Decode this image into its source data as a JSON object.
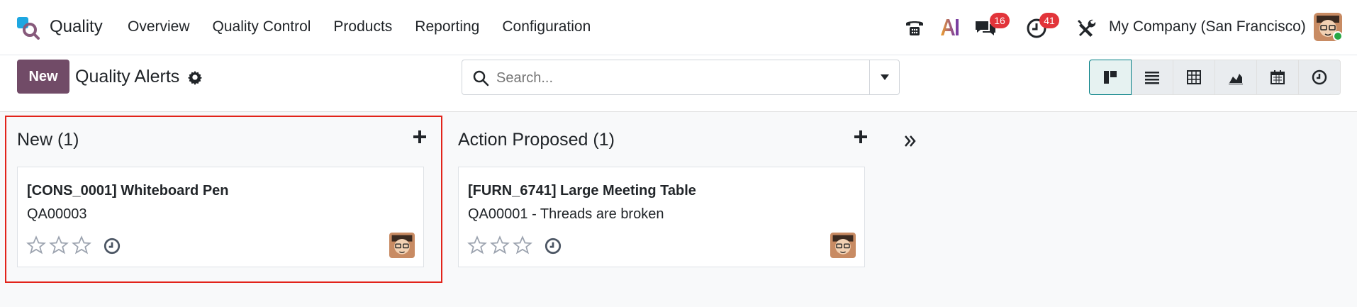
{
  "app": {
    "name": "Quality"
  },
  "menu": [
    "Overview",
    "Quality Control",
    "Products",
    "Reporting",
    "Configuration"
  ],
  "systray": {
    "messages_count": "16",
    "activities_count": "41",
    "company": "My Company (San Francisco)"
  },
  "control": {
    "new_label": "New",
    "title": "Quality Alerts",
    "search_placeholder": "Search..."
  },
  "views": [
    "kanban-icon",
    "list-icon",
    "pivot-icon",
    "graph-icon",
    "calendar-icon",
    "activity-icon"
  ],
  "columns": [
    {
      "header": "New (1)",
      "card": {
        "title": "[CONS_0001] Whiteboard Pen",
        "subtitle": "QA00003"
      }
    },
    {
      "header": "Action Proposed (1)",
      "card": {
        "title": "[FURN_6741] Large Meeting Table",
        "subtitle": "QA00001 - Threads are broken"
      }
    }
  ],
  "colors": {
    "brand": "#714b67",
    "badge": "#e2343a",
    "highlight": "#e2231a",
    "accent": "#017e84"
  }
}
